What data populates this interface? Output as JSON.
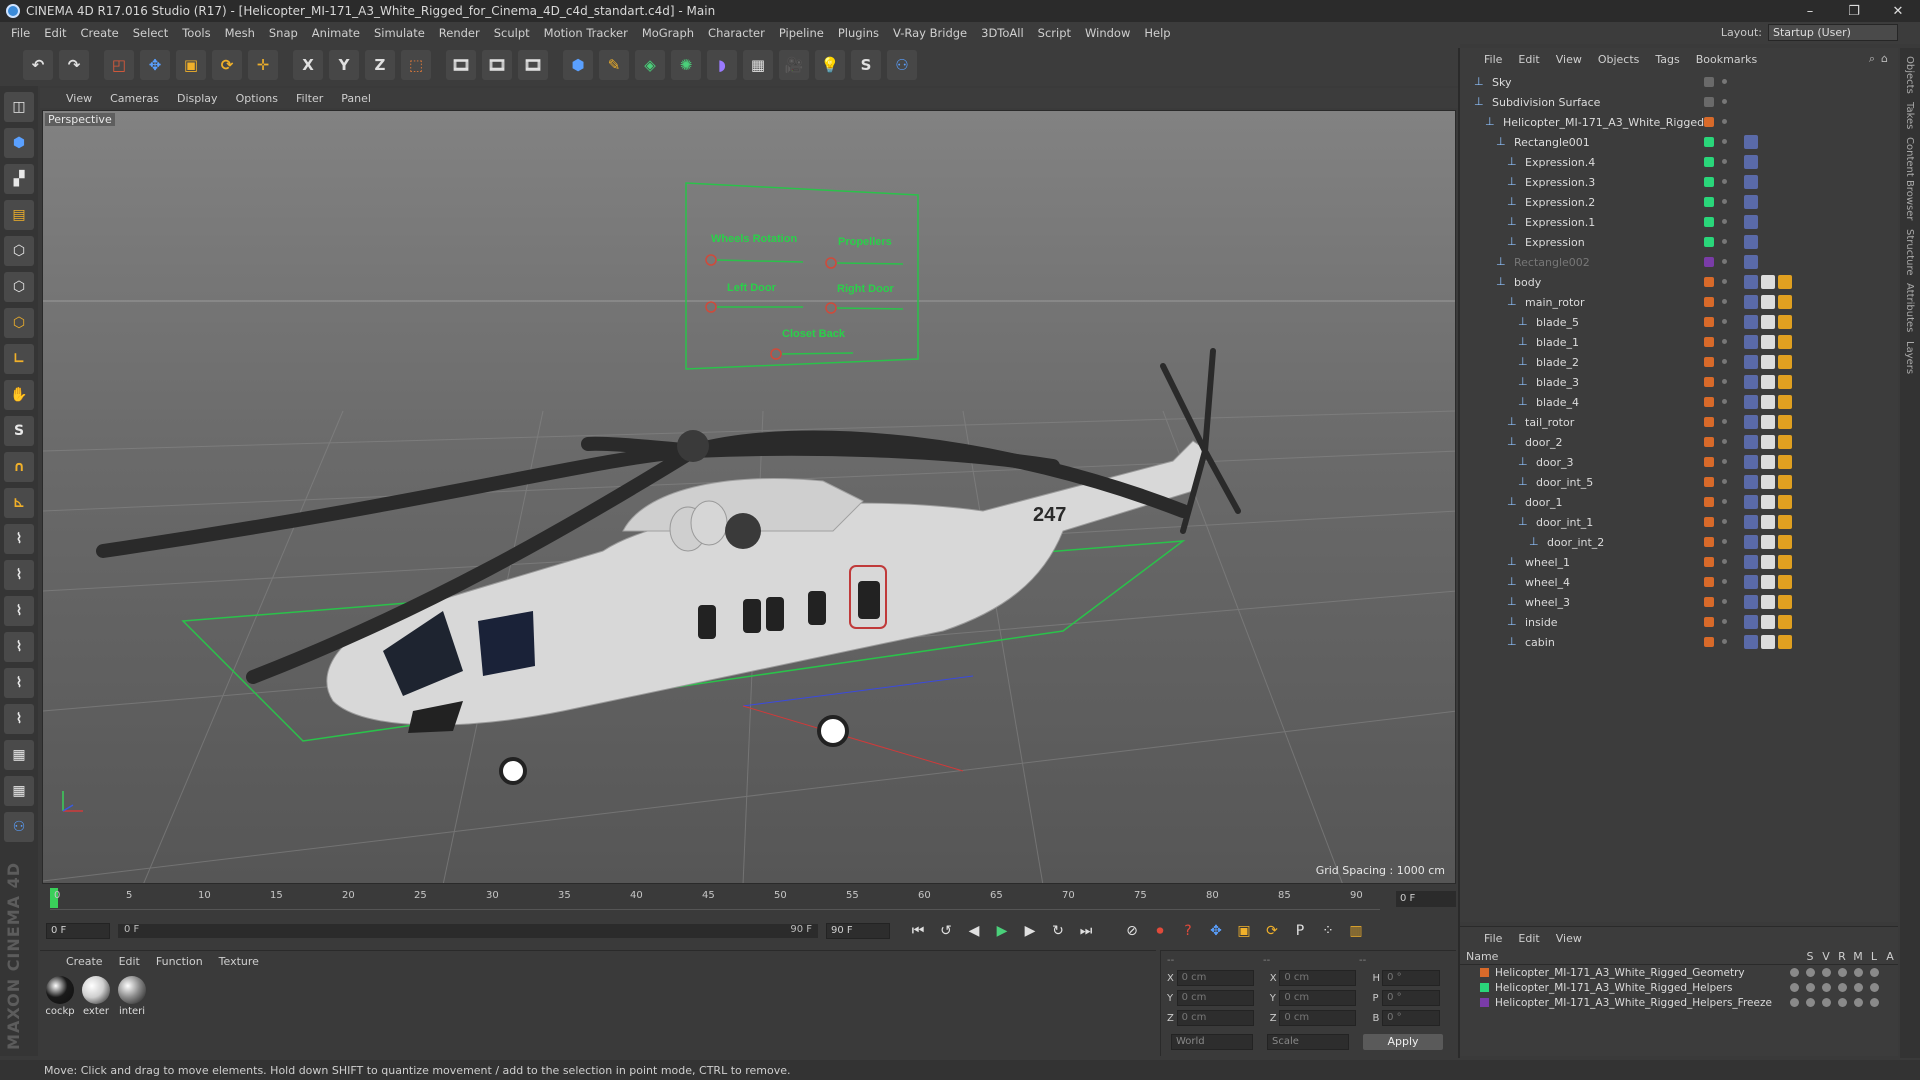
{
  "app": {
    "title": "CINEMA 4D R17.016 Studio (R17) - [Helicopter_MI-171_A3_White_Rigged_for_Cinema_4D_c4d_standart.c4d] - Main",
    "layout_label": "Layout:",
    "layout_value": "Startup (User)"
  },
  "menu": [
    "File",
    "Edit",
    "Create",
    "Select",
    "Tools",
    "Mesh",
    "Snap",
    "Animate",
    "Simulate",
    "Render",
    "Sculpt",
    "Motion Tracker",
    "MoGraph",
    "Character",
    "Pipeline",
    "Plugins",
    "V-Ray Bridge",
    "3DToAll",
    "Script",
    "Window",
    "Help"
  ],
  "toolbar": {
    "x_label": "X",
    "y_label": "Y",
    "z_label": "Z"
  },
  "viewport": {
    "menu": [
      "View",
      "Cameras",
      "Display",
      "Options",
      "Filter",
      "Panel"
    ],
    "label": "Perspective",
    "grid_spacing": "Grid Spacing : 1000 cm",
    "rig_panel": {
      "labels": [
        "Wheels Rotation",
        "Propellers",
        "Left Door",
        "Right Door",
        "Closet Back"
      ]
    },
    "tail_number": "247"
  },
  "timeline": {
    "ticks": [
      "0",
      "5",
      "10",
      "15",
      "20",
      "25",
      "30",
      "35",
      "40",
      "45",
      "50",
      "55",
      "60",
      "65",
      "70",
      "75",
      "80",
      "85",
      "90"
    ],
    "current_frame": "0 F"
  },
  "transport": {
    "start_field": "0 F",
    "range_start": "0 F",
    "range_end": "90 F",
    "end_field": "90 F"
  },
  "materials": {
    "menu": [
      "Create",
      "Edit",
      "Function",
      "Texture"
    ],
    "items": [
      {
        "name": "cockp",
        "color": "#1a1a1a"
      },
      {
        "name": "exter",
        "color": "#cfcfcf"
      },
      {
        "name": "interi",
        "color": "#8c8c8c"
      }
    ]
  },
  "coordinates": {
    "headers": [
      "--",
      "--",
      "--"
    ],
    "rows": [
      {
        "axis": "X",
        "pos": "0 cm",
        "axis2": "X",
        "size": "0 cm",
        "rot_label": "H",
        "rot": "0 °"
      },
      {
        "axis": "Y",
        "pos": "0 cm",
        "axis2": "Y",
        "size": "0 cm",
        "rot_label": "P",
        "rot": "0 °"
      },
      {
        "axis": "Z",
        "pos": "0 cm",
        "axis2": "Z",
        "size": "0 cm",
        "rot_label": "B",
        "rot": "0 °"
      }
    ],
    "mode": "World",
    "scale": "Scale",
    "apply_label": "Apply"
  },
  "object_manager": {
    "menu": [
      "File",
      "Edit",
      "View",
      "Objects",
      "Tags",
      "Bookmarks"
    ],
    "objects": [
      {
        "name": "Sky",
        "tag_color": "#6a6a6a"
      },
      {
        "name": "Subdivision Surface",
        "tag_color": "#6a6a6a"
      },
      {
        "name": "Helicopter_MI-171_A3_White_Rigged",
        "tag_color": "#d86a2a"
      },
      {
        "name": "Rectangle001",
        "tag_color": "#2ad67a"
      },
      {
        "name": "Expression.4",
        "tag_color": "#2ad67a"
      },
      {
        "name": "Expression.3",
        "tag_color": "#2ad67a"
      },
      {
        "name": "Expression.2",
        "tag_color": "#2ad67a"
      },
      {
        "name": "Expression.1",
        "tag_color": "#2ad67a"
      },
      {
        "name": "Expression",
        "tag_color": "#2ad67a"
      },
      {
        "name": "Rectangle002",
        "tag_color": "#7a3ca8"
      },
      {
        "name": "body",
        "tag_color": "#d86a2a"
      },
      {
        "name": "main_rotor",
        "tag_color": "#d86a2a"
      },
      {
        "name": "blade_5",
        "tag_color": "#d86a2a"
      },
      {
        "name": "blade_1",
        "tag_color": "#d86a2a"
      },
      {
        "name": "blade_2",
        "tag_color": "#d86a2a"
      },
      {
        "name": "blade_3",
        "tag_color": "#d86a2a"
      },
      {
        "name": "blade_4",
        "tag_color": "#d86a2a"
      },
      {
        "name": "tail_rotor",
        "tag_color": "#d86a2a"
      },
      {
        "name": "door_2",
        "tag_color": "#d86a2a"
      },
      {
        "name": "door_3",
        "tag_color": "#d86a2a"
      },
      {
        "name": "door_int_5",
        "tag_color": "#d86a2a"
      },
      {
        "name": "door_1",
        "tag_color": "#d86a2a"
      },
      {
        "name": "door_int_1",
        "tag_color": "#d86a2a"
      },
      {
        "name": "door_int_2",
        "tag_color": "#d86a2a"
      },
      {
        "name": "wheel_1",
        "tag_color": "#d86a2a"
      },
      {
        "name": "wheel_4",
        "tag_color": "#d86a2a"
      },
      {
        "name": "wheel_3",
        "tag_color": "#d86a2a"
      },
      {
        "name": "inside",
        "tag_color": "#d86a2a"
      },
      {
        "name": "cabin",
        "tag_color": "#d86a2a"
      }
    ]
  },
  "layers": {
    "menu": [
      "File",
      "Edit",
      "View"
    ],
    "header_name": "Name",
    "columns": [
      "S",
      "V",
      "R",
      "M",
      "L",
      "A"
    ],
    "items": [
      {
        "name": "Helicopter_MI-171_A3_White_Rigged_Geometry",
        "color": "#d86a2a"
      },
      {
        "name": "Helicopter_MI-171_A3_White_Rigged_Helpers",
        "color": "#2ad67a"
      },
      {
        "name": "Helicopter_MI-171_A3_White_Rigged_Helpers_Freeze",
        "color": "#7a3ca8"
      }
    ]
  },
  "right_tabs": [
    "Objects",
    "Takes",
    "Content Browser",
    "Structure",
    "Attributes",
    "Layers"
  ],
  "brand": "MAXON CINEMA 4D",
  "status": "Move: Click and drag to move elements. Hold down SHIFT to quantize movement / add to the selection in point mode, CTRL to remove."
}
